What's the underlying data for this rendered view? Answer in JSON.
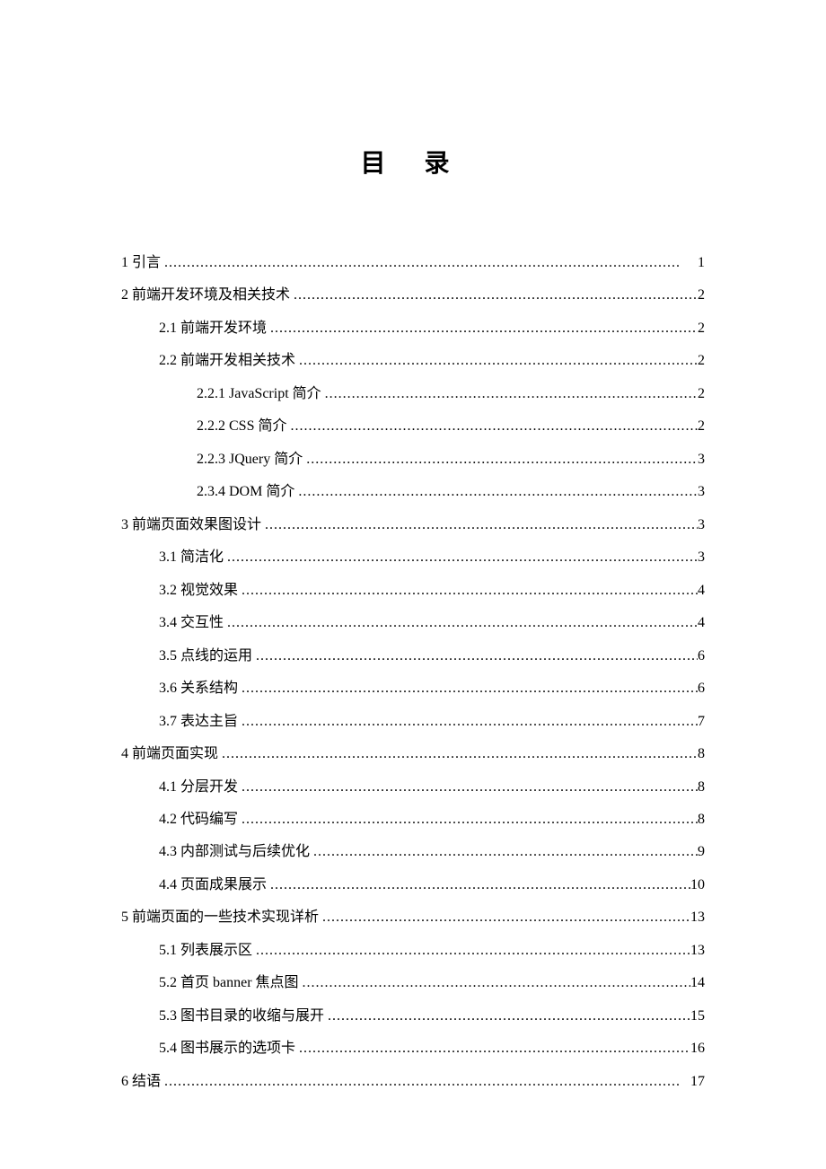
{
  "title": "目 录",
  "entries": [
    {
      "level": 1,
      "num": "1",
      "text": "引言",
      "page": "1"
    },
    {
      "level": 1,
      "num": "2",
      "text": "前端开发环境及相关技术",
      "page": "2"
    },
    {
      "level": 2,
      "num": "2.1",
      "text": "前端开发环境",
      "page": "2"
    },
    {
      "level": 2,
      "num": "2.2",
      "text": "前端开发相关技术",
      "page": "2"
    },
    {
      "level": 3,
      "num": "2.2.1",
      "text": "JavaScript 简介 ",
      "page": "2"
    },
    {
      "level": 3,
      "num": "2.2.2",
      "text": "CSS 简介 ",
      "page": "2"
    },
    {
      "level": 3,
      "num": "2.2.3",
      "text": "JQuery 简介 ",
      "page": "3"
    },
    {
      "level": 3,
      "num": "2.3.4",
      "text": "DOM 简介 ",
      "page": "3"
    },
    {
      "level": 1,
      "num": "3",
      "text": "前端页面效果图设计",
      "page": "3"
    },
    {
      "level": 2,
      "num": "3.1",
      "text": "简洁化",
      "page": "3"
    },
    {
      "level": 2,
      "num": "3.2",
      "text": "视觉效果",
      "page": "4"
    },
    {
      "level": 2,
      "num": "3.4",
      "text": "交互性",
      "page": "4"
    },
    {
      "level": 2,
      "num": "3.5",
      "text": "点线的运用",
      "page": "6"
    },
    {
      "level": 2,
      "num": "3.6",
      "text": "关系结构",
      "page": "6"
    },
    {
      "level": 2,
      "num": "3.7",
      "text": "表达主旨",
      "page": "7"
    },
    {
      "level": 1,
      "num": "4",
      "text": "前端页面实现",
      "page": "8"
    },
    {
      "level": 2,
      "num": "4.1",
      "text": "分层开发",
      "page": "8"
    },
    {
      "level": 2,
      "num": "4.2",
      "text": "代码编写",
      "page": "8"
    },
    {
      "level": 2,
      "num": "4.3",
      "text": "内部测试与后续优化",
      "page": "9"
    },
    {
      "level": 2,
      "num": "4.4",
      "text": "页面成果展示",
      "page": "10"
    },
    {
      "level": 1,
      "num": "5",
      "text": "前端页面的一些技术实现详析",
      "page": "13"
    },
    {
      "level": 2,
      "num": "5.1",
      "text": "列表展示区",
      "page": "13"
    },
    {
      "level": 2,
      "num": "5.2",
      "text": "首页 banner 焦点图",
      "page": "14"
    },
    {
      "level": 2,
      "num": "5.3",
      "text": "图书目录的收缩与展开",
      "page": "15"
    },
    {
      "level": 2,
      "num": "5.4",
      "text": "图书展示的选项卡",
      "page": "16"
    },
    {
      "level": 1,
      "num": "6",
      "text": "结语",
      "page": "17"
    }
  ]
}
